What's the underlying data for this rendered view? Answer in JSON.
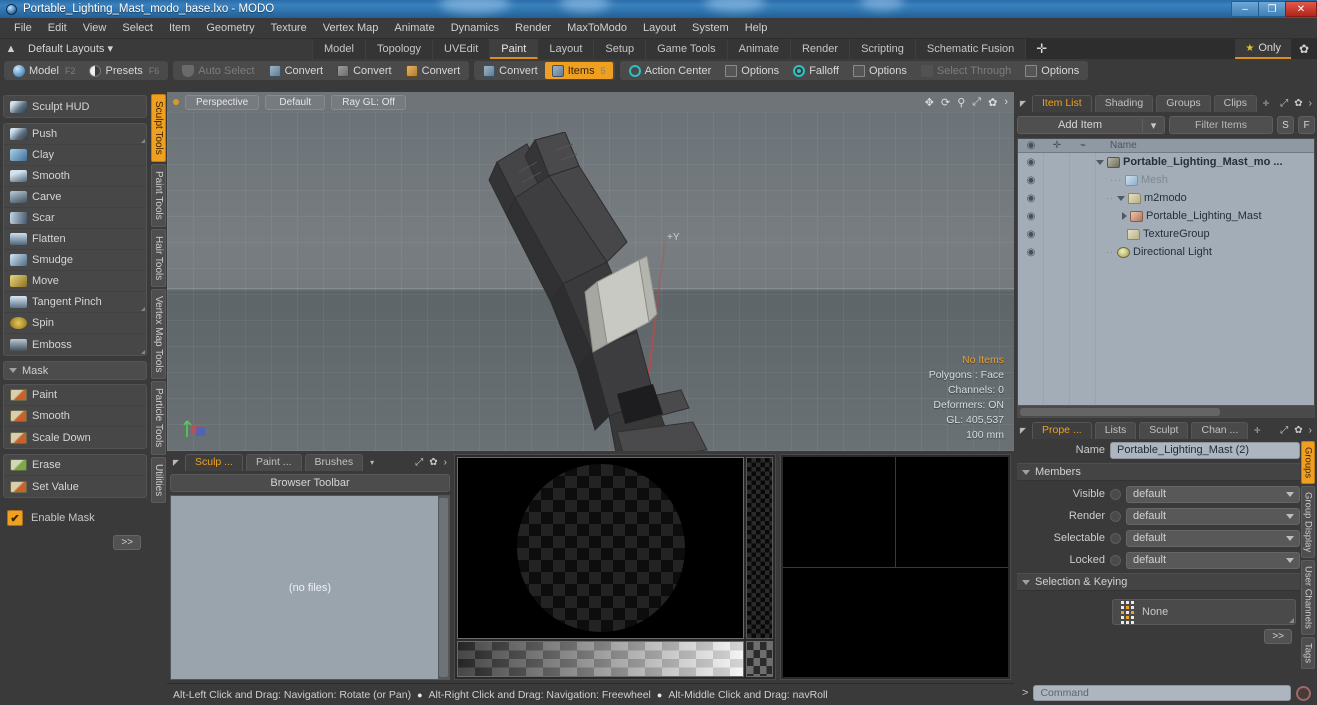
{
  "window": {
    "title": "Portable_Lighting_Mast_modo_base.lxo - MODO",
    "minimize": "–",
    "maximize": "❐",
    "close": "✕"
  },
  "menubar": {
    "items": [
      "File",
      "Edit",
      "View",
      "Select",
      "Item",
      "Geometry",
      "Texture",
      "Vertex Map",
      "Animate",
      "Dynamics",
      "Render",
      "MaxToModo",
      "Layout",
      "System",
      "Help"
    ]
  },
  "layoutbar": {
    "home_icon": "▲",
    "layouts_label": "Default Layouts ▾",
    "tabs": [
      "Model",
      "Topology",
      "UVEdit",
      "Paint",
      "Layout",
      "Setup",
      "Game Tools",
      "Animate",
      "Render",
      "Scripting",
      "Schematic Fusion"
    ],
    "active_tab": "Paint",
    "plus": "✛",
    "only_label": "Only",
    "star_glyph": "★",
    "gear_glyph": "✿"
  },
  "modebar": {
    "group1": [
      {
        "label": "Model",
        "key": "F2",
        "icon": "sphere-icon",
        "state": "normal"
      },
      {
        "label": "Presets",
        "key": "F6",
        "icon": "half-sphere-icon",
        "state": "normal"
      }
    ],
    "group2": [
      {
        "label": "Auto Select",
        "icon": "shield-icon",
        "state": "dim"
      },
      {
        "label": "Convert",
        "icon": "cube-blue-icon",
        "state": "normal"
      },
      {
        "label": "Convert",
        "icon": "cube-yellow-icon",
        "state": "normal"
      },
      {
        "label": "Convert",
        "icon": "cube-orange-icon",
        "state": "normal"
      }
    ],
    "group3": [
      {
        "label": "Convert",
        "icon": "cube-blue-icon",
        "state": "normal"
      },
      {
        "label": "Items",
        "key": "5",
        "icon": "cube-gray-icon",
        "state": "selected"
      }
    ],
    "group4": [
      {
        "label": "Action Center",
        "icon": "target-icon",
        "state": "normal"
      },
      {
        "label": "Options",
        "icon": "checkbox-icon",
        "state": "normal"
      },
      {
        "label": "Falloff",
        "icon": "falloff-icon",
        "state": "normal"
      },
      {
        "label": "Options",
        "icon": "checkbox-icon",
        "state": "normal"
      },
      {
        "label": "Select Through",
        "icon": "select-through-icon",
        "state": "dim"
      },
      {
        "label": "Options",
        "icon": "checkbox-icon",
        "state": "normal"
      }
    ]
  },
  "left_panel": {
    "hud_label": "Sculpt HUD",
    "hud_icon": "hud-icon",
    "brushes": [
      {
        "label": "Push",
        "icon": "brush-push-icon",
        "corner": true
      },
      {
        "label": "Clay",
        "icon": "brush-clay-icon",
        "corner": false
      },
      {
        "label": "Smooth",
        "icon": "brush-smooth-icon",
        "corner": false
      },
      {
        "label": "Carve",
        "icon": "brush-carve-icon",
        "corner": false
      },
      {
        "label": "Scar",
        "icon": "brush-scar-icon",
        "corner": false
      },
      {
        "label": "Flatten",
        "icon": "brush-flatten-icon",
        "corner": false
      },
      {
        "label": "Smudge",
        "icon": "brush-smudge-icon",
        "corner": false
      },
      {
        "label": "Move",
        "icon": "brush-move-icon",
        "corner": false
      },
      {
        "label": "Tangent Pinch",
        "icon": "brush-tangent-pinch-icon",
        "corner": true
      },
      {
        "label": "Spin",
        "icon": "brush-spin-icon",
        "corner": false
      },
      {
        "label": "Emboss",
        "icon": "brush-emboss-icon",
        "corner": true
      }
    ],
    "mask_header": "Mask",
    "mask_items": [
      {
        "label": "Paint",
        "icon": "mask-paint-icon"
      },
      {
        "label": "Smooth",
        "icon": "mask-smooth-icon"
      },
      {
        "label": "Scale Down",
        "icon": "mask-scale-down-icon"
      }
    ],
    "mask_items2": [
      {
        "label": "Erase",
        "icon": "mask-erase-icon"
      },
      {
        "label": "Set Value",
        "icon": "mask-set-value-icon"
      }
    ],
    "enable_mask_label": "Enable Mask",
    "enable_mask_checked": true,
    "more_label": ">>"
  },
  "left_vtabs": {
    "items": [
      "Sculpt Tools",
      "Paint Tools",
      "Hair Tools",
      "Vertex Map Tools",
      "Particle Tools",
      "Utilities"
    ],
    "active": "Sculpt Tools"
  },
  "viewport": {
    "buttons": [
      "Perspective",
      "Default",
      "Ray GL: Off"
    ],
    "icons": [
      "move-icon",
      "rotate-icon",
      "zoom-icon",
      "fit-icon",
      "gear-icon",
      "chevron-right-icon"
    ],
    "axis_label": "+Y",
    "stats": {
      "selection": "No Items",
      "polygons": "Polygons : Face",
      "channels": "Channels: 0",
      "deformers": "Deformers: ON",
      "gl": "GL: 405,537",
      "scale": "100 mm"
    }
  },
  "browser_panel": {
    "tabs": [
      "Sculp ...",
      "Paint ...",
      "Brushes"
    ],
    "active_tab": "Sculp ...",
    "dropdown_glyph": "▾",
    "toolbar_label": "Browser Toolbar",
    "empty_label": "(no files)"
  },
  "statusbar": {
    "hints": [
      "Alt-Left Click and Drag: Navigation: Rotate (or Pan)",
      "Alt-Right Click and Drag: Navigation: Freewheel",
      "Alt-Middle Click and Drag: navRoll"
    ],
    "bullet": "●"
  },
  "item_list": {
    "tabs": [
      "Item List",
      "Shading",
      "Groups",
      "Clips"
    ],
    "active_tab": "Item List",
    "plus": "✛",
    "add_item_label": "Add Item",
    "filter_placeholder": "Filter Items",
    "btn_s": "S",
    "btn_f": "F",
    "columns": {
      "eye": "eye-icon",
      "lock": "add-icon",
      "shape": "deformer-icon",
      "name": "Name"
    },
    "rows": [
      {
        "name": "Portable_Lighting_Mast_mo ...",
        "indent": 0,
        "icon": "scene-icon",
        "toggle": "down",
        "bold": true,
        "gray": false
      },
      {
        "name": "Mesh",
        "indent": 1,
        "icon": "mesh-icon",
        "toggle": "dots",
        "bold": false,
        "gray": true
      },
      {
        "name": "m2modo",
        "indent": 1,
        "icon": "folder-icon",
        "toggle": "down",
        "bold": false,
        "gray": false
      },
      {
        "name": "Portable_Lighting_Mast",
        "indent": 2,
        "icon": "locator-icon",
        "toggle": "right",
        "bold": false,
        "gray": false
      },
      {
        "name": "TextureGroup",
        "indent": 2,
        "icon": "folder-icon",
        "toggle": "none",
        "bold": false,
        "gray": false
      },
      {
        "name": "Directional Light",
        "indent": 1,
        "icon": "light-icon",
        "toggle": "dots",
        "bold": false,
        "gray": false
      }
    ],
    "eye_glyph": "◉"
  },
  "properties": {
    "tabs": [
      "Prope ...",
      "Lists",
      "Sculpt",
      "Chan ..."
    ],
    "active_tab": "Prope ...",
    "plus": "✛",
    "name_label": "Name",
    "name_value": "Portable_Lighting_Mast (2)",
    "members_section": "Members",
    "fields": [
      {
        "label": "Visible",
        "value": "default"
      },
      {
        "label": "Render",
        "value": "default"
      },
      {
        "label": "Selectable",
        "value": "default"
      },
      {
        "label": "Locked",
        "value": "default"
      }
    ],
    "selection_section": "Selection & Keying",
    "selection_value": "None",
    "more_label": ">>"
  },
  "right_vtabs": {
    "items": [
      "Groups",
      "Group Display",
      "User Channels",
      "Tags"
    ],
    "active": "Groups"
  },
  "command_bar": {
    "prompt": ">",
    "placeholder": "Command"
  },
  "colors": {
    "accent": "#f0a020",
    "panel": "#3a3a3a",
    "list_bg": "#a3adb8",
    "title_blue": "#2f74ae"
  }
}
